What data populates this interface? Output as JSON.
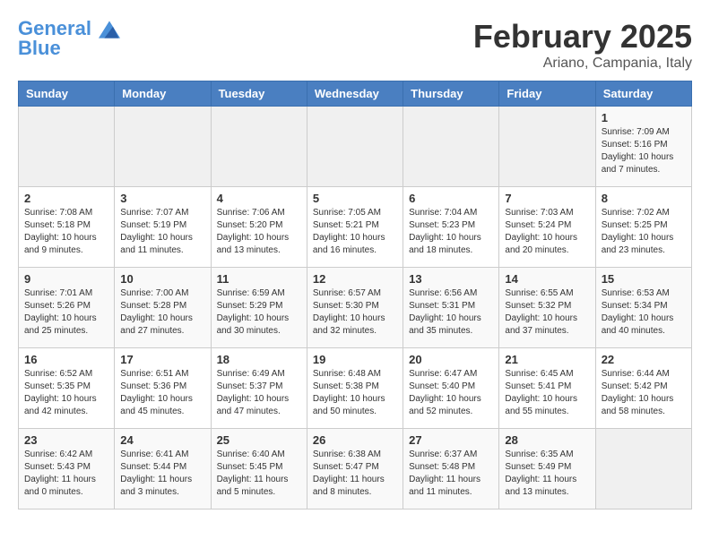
{
  "header": {
    "logo_line1": "General",
    "logo_line2": "Blue",
    "month_title": "February 2025",
    "subtitle": "Ariano, Campania, Italy"
  },
  "weekdays": [
    "Sunday",
    "Monday",
    "Tuesday",
    "Wednesday",
    "Thursday",
    "Friday",
    "Saturday"
  ],
  "weeks": [
    [
      {
        "day": "",
        "info": ""
      },
      {
        "day": "",
        "info": ""
      },
      {
        "day": "",
        "info": ""
      },
      {
        "day": "",
        "info": ""
      },
      {
        "day": "",
        "info": ""
      },
      {
        "day": "",
        "info": ""
      },
      {
        "day": "1",
        "info": "Sunrise: 7:09 AM\nSunset: 5:16 PM\nDaylight: 10 hours and 7 minutes."
      }
    ],
    [
      {
        "day": "2",
        "info": "Sunrise: 7:08 AM\nSunset: 5:18 PM\nDaylight: 10 hours and 9 minutes."
      },
      {
        "day": "3",
        "info": "Sunrise: 7:07 AM\nSunset: 5:19 PM\nDaylight: 10 hours and 11 minutes."
      },
      {
        "day": "4",
        "info": "Sunrise: 7:06 AM\nSunset: 5:20 PM\nDaylight: 10 hours and 13 minutes."
      },
      {
        "day": "5",
        "info": "Sunrise: 7:05 AM\nSunset: 5:21 PM\nDaylight: 10 hours and 16 minutes."
      },
      {
        "day": "6",
        "info": "Sunrise: 7:04 AM\nSunset: 5:23 PM\nDaylight: 10 hours and 18 minutes."
      },
      {
        "day": "7",
        "info": "Sunrise: 7:03 AM\nSunset: 5:24 PM\nDaylight: 10 hours and 20 minutes."
      },
      {
        "day": "8",
        "info": "Sunrise: 7:02 AM\nSunset: 5:25 PM\nDaylight: 10 hours and 23 minutes."
      }
    ],
    [
      {
        "day": "9",
        "info": "Sunrise: 7:01 AM\nSunset: 5:26 PM\nDaylight: 10 hours and 25 minutes."
      },
      {
        "day": "10",
        "info": "Sunrise: 7:00 AM\nSunset: 5:28 PM\nDaylight: 10 hours and 27 minutes."
      },
      {
        "day": "11",
        "info": "Sunrise: 6:59 AM\nSunset: 5:29 PM\nDaylight: 10 hours and 30 minutes."
      },
      {
        "day": "12",
        "info": "Sunrise: 6:57 AM\nSunset: 5:30 PM\nDaylight: 10 hours and 32 minutes."
      },
      {
        "day": "13",
        "info": "Sunrise: 6:56 AM\nSunset: 5:31 PM\nDaylight: 10 hours and 35 minutes."
      },
      {
        "day": "14",
        "info": "Sunrise: 6:55 AM\nSunset: 5:32 PM\nDaylight: 10 hours and 37 minutes."
      },
      {
        "day": "15",
        "info": "Sunrise: 6:53 AM\nSunset: 5:34 PM\nDaylight: 10 hours and 40 minutes."
      }
    ],
    [
      {
        "day": "16",
        "info": "Sunrise: 6:52 AM\nSunset: 5:35 PM\nDaylight: 10 hours and 42 minutes."
      },
      {
        "day": "17",
        "info": "Sunrise: 6:51 AM\nSunset: 5:36 PM\nDaylight: 10 hours and 45 minutes."
      },
      {
        "day": "18",
        "info": "Sunrise: 6:49 AM\nSunset: 5:37 PM\nDaylight: 10 hours and 47 minutes."
      },
      {
        "day": "19",
        "info": "Sunrise: 6:48 AM\nSunset: 5:38 PM\nDaylight: 10 hours and 50 minutes."
      },
      {
        "day": "20",
        "info": "Sunrise: 6:47 AM\nSunset: 5:40 PM\nDaylight: 10 hours and 52 minutes."
      },
      {
        "day": "21",
        "info": "Sunrise: 6:45 AM\nSunset: 5:41 PM\nDaylight: 10 hours and 55 minutes."
      },
      {
        "day": "22",
        "info": "Sunrise: 6:44 AM\nSunset: 5:42 PM\nDaylight: 10 hours and 58 minutes."
      }
    ],
    [
      {
        "day": "23",
        "info": "Sunrise: 6:42 AM\nSunset: 5:43 PM\nDaylight: 11 hours and 0 minutes."
      },
      {
        "day": "24",
        "info": "Sunrise: 6:41 AM\nSunset: 5:44 PM\nDaylight: 11 hours and 3 minutes."
      },
      {
        "day": "25",
        "info": "Sunrise: 6:40 AM\nSunset: 5:45 PM\nDaylight: 11 hours and 5 minutes."
      },
      {
        "day": "26",
        "info": "Sunrise: 6:38 AM\nSunset: 5:47 PM\nDaylight: 11 hours and 8 minutes."
      },
      {
        "day": "27",
        "info": "Sunrise: 6:37 AM\nSunset: 5:48 PM\nDaylight: 11 hours and 11 minutes."
      },
      {
        "day": "28",
        "info": "Sunrise: 6:35 AM\nSunset: 5:49 PM\nDaylight: 11 hours and 13 minutes."
      },
      {
        "day": "",
        "info": ""
      }
    ]
  ]
}
